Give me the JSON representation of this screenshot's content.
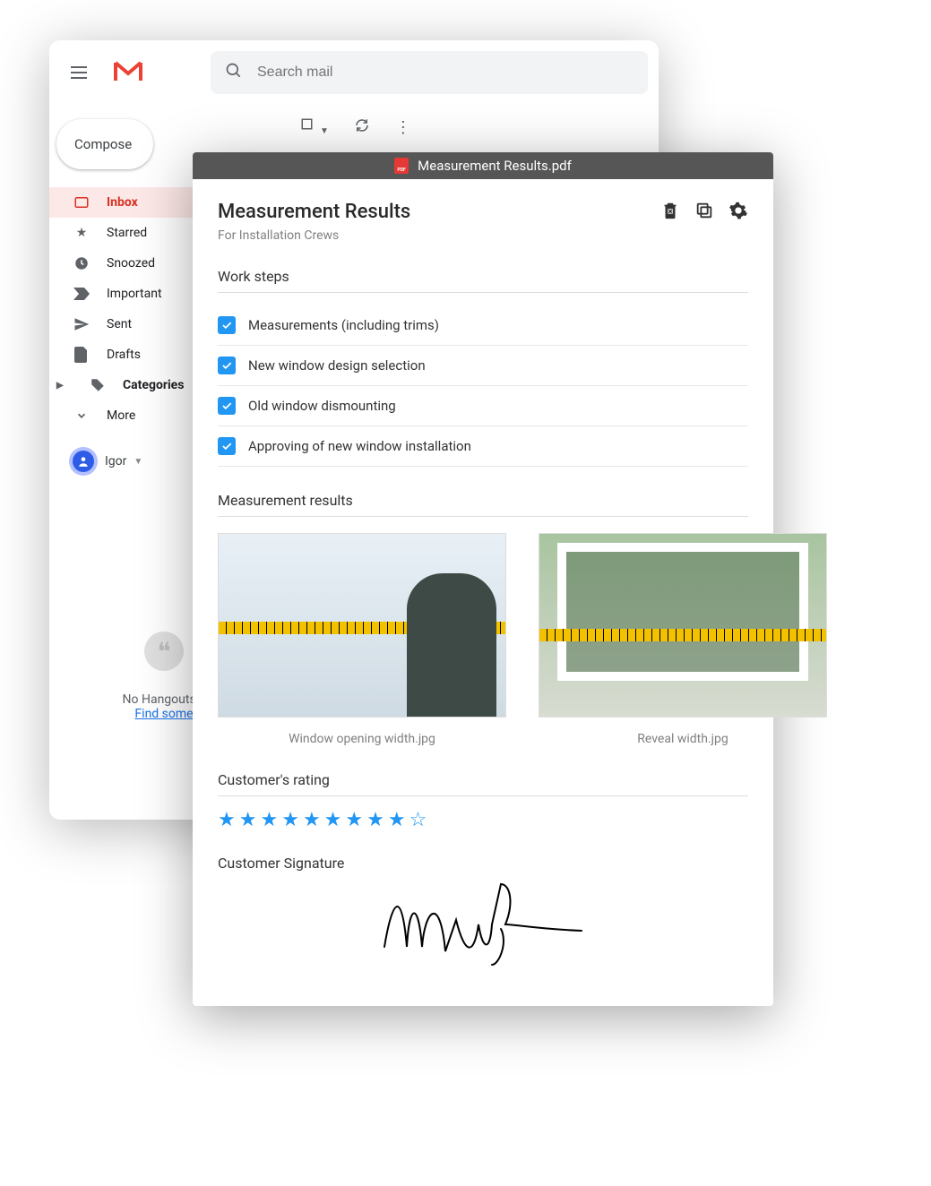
{
  "gmail": {
    "search_placeholder": "Search mail",
    "compose_label": "Compose",
    "user_name": "Igor",
    "nav": [
      {
        "label": "Inbox",
        "active": true
      },
      {
        "label": "Starred"
      },
      {
        "label": "Snoozed"
      },
      {
        "label": "Important"
      },
      {
        "label": "Sent"
      },
      {
        "label": "Drafts"
      },
      {
        "label": "Categories",
        "bold": true
      },
      {
        "label": "More"
      }
    ],
    "hangouts": {
      "line1": "No Hangouts c",
      "link": "Find some"
    }
  },
  "pdf": {
    "filename": "Measurement Results.pdf",
    "title": "Measurement Results",
    "subtitle": "For Installation Crews",
    "work_steps_heading": "Work steps",
    "results_heading": "Measurement results",
    "rating_heading": "Customer's rating",
    "signature_heading": "Customer Signature",
    "steps": [
      "Measurements (including trims)",
      "New window design selection",
      "Old window dismounting",
      "Approving of new window installation"
    ],
    "images": [
      {
        "caption": "Window opening width.jpg"
      },
      {
        "caption": "Reveal width.jpg"
      }
    ],
    "rating": {
      "filled": 9,
      "total": 10
    }
  }
}
